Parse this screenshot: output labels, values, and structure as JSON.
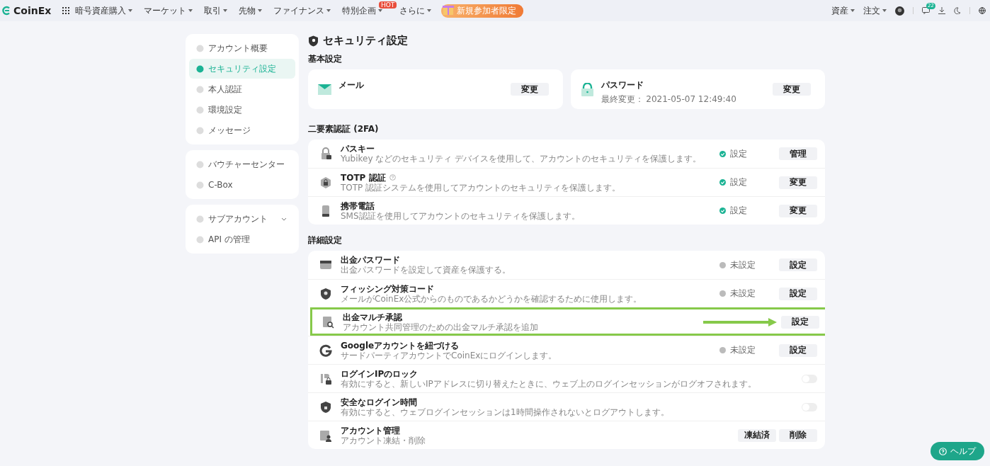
{
  "topbar": {
    "logo": "CoinEx",
    "nav": [
      {
        "label": "暗号資産購入"
      },
      {
        "label": "マーケット"
      },
      {
        "label": "取引"
      },
      {
        "label": "先物"
      },
      {
        "label": "ファイナンス"
      },
      {
        "label": "特別企画",
        "badge": "HOT"
      },
      {
        "label": "さらに"
      }
    ],
    "promo": "新規参加者限定",
    "right_menus": [
      "資産",
      "注文"
    ],
    "message_count": "22"
  },
  "sidebar": {
    "groups": [
      {
        "items": [
          {
            "label": "アカウント概要",
            "selected": false
          },
          {
            "label": "セキュリティ設定",
            "selected": true
          },
          {
            "label": "本人認証",
            "selected": false
          },
          {
            "label": "環境設定",
            "selected": false
          },
          {
            "label": "メッセージ",
            "selected": false
          }
        ]
      },
      {
        "items": [
          {
            "label": "バウチャーセンター",
            "selected": false
          },
          {
            "label": "C-Box",
            "selected": false
          }
        ]
      },
      {
        "items": [
          {
            "label": "サブアカウント",
            "selected": false,
            "expanded": false
          },
          {
            "label": "API の管理",
            "selected": false
          }
        ]
      }
    ]
  },
  "page_title": "セキュリティ設定",
  "basic": {
    "heading": "基本設定",
    "cards": [
      {
        "title": "メール",
        "button": "変更"
      },
      {
        "title": "パスワード",
        "detail": "最終変更： 2021-05-07 12:49:40",
        "button": "変更"
      }
    ]
  },
  "twofa": {
    "heading": "二要素認証 (2FA)",
    "rows": [
      {
        "kind": "status",
        "title": "パスキー",
        "help": false,
        "desc": "Yubikey などのセキュリティ デバイスを使用して、アカウントのセキュリティを保護します。",
        "set": true,
        "status": "設定",
        "buttons": [
          "管理"
        ]
      },
      {
        "kind": "status",
        "title": "TOTP 認証",
        "help": true,
        "desc": "TOTP 認証システムを使用してアカウントのセキュリティを保護します。",
        "set": true,
        "status": "設定",
        "buttons": [
          "変更"
        ]
      },
      {
        "kind": "status",
        "title": "携帯電話",
        "help": false,
        "desc": "SMS認証を使用してアカウントのセキュリティを保護します。",
        "set": true,
        "status": "設定",
        "buttons": [
          "変更"
        ]
      }
    ]
  },
  "advanced": {
    "heading": "詳細設定",
    "rows": [
      {
        "kind": "status",
        "title": "出金パスワード",
        "desc": "出金パスワードを設定して資産を保護する。",
        "set": false,
        "status": "未設定",
        "buttons": [
          "設定"
        ],
        "highlighted": false
      },
      {
        "kind": "status",
        "title": "フィッシング対策コード",
        "desc": "メールがCoinEx公式からのものであるかどうかを確認するために使用します。",
        "set": false,
        "status": "未設定",
        "buttons": [
          "設定"
        ],
        "highlighted": false
      },
      {
        "kind": "buttons",
        "title": "出金マルチ承認",
        "desc": "アカウント共同管理のための出金マルチ承認を追加",
        "buttons": [
          "設定"
        ],
        "highlighted": true
      },
      {
        "kind": "status",
        "title": "Googleアカウントを紐づける",
        "desc": "サードパーティアカウントでCoinExにログインします。",
        "set": false,
        "status": "未設定",
        "buttons": [
          "設定"
        ],
        "highlighted": false
      },
      {
        "kind": "toggle",
        "title": "ログインIPのロック",
        "desc": "有効にすると、新しいIPアドレスに切り替えたときに、ウェブ上のログインセッションがログオフされます。",
        "on": false,
        "highlighted": false
      },
      {
        "kind": "toggle",
        "title": "安全なログイン時間",
        "desc": "有効にすると、ウェブログインセッションは1時間操作されないとログアウトします。",
        "on": false,
        "highlighted": false
      },
      {
        "kind": "buttons",
        "title": "アカウント管理",
        "desc": "アカウント凍結・削除",
        "buttons": [
          "凍結済",
          "削除"
        ],
        "highlighted": false
      }
    ]
  },
  "help_button": "ヘルプ"
}
